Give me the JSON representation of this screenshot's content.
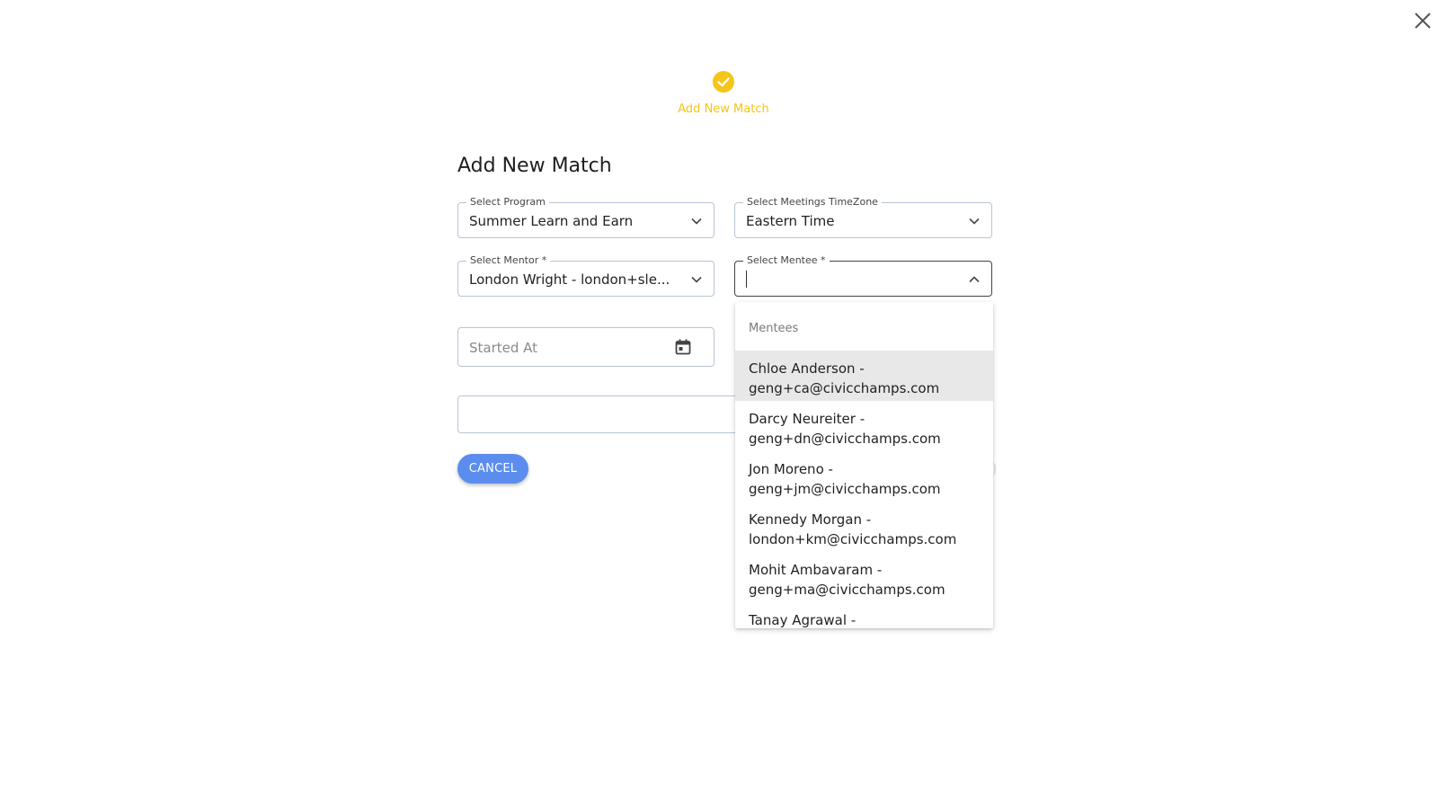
{
  "dialog": {
    "close_icon": "close-icon"
  },
  "stepper": {
    "icon": "check-circle-icon",
    "label": "Add New Match",
    "accent_color": "#f5c518"
  },
  "form": {
    "title": "Add New Match",
    "program": {
      "legend": "Select Program",
      "value": "Summer Learn and Earn"
    },
    "timezone": {
      "legend": "Select Meetings TimeZone",
      "value": "Eastern Time"
    },
    "mentor": {
      "legend": "Select Mentor *",
      "value": "London Wright - london+sle..."
    },
    "mentee": {
      "legend": "Select Mentee *",
      "value": ""
    },
    "started_at": {
      "placeholder": "Started At",
      "icon": "calendar-icon"
    },
    "cancel_label": "CANCEL",
    "button_color": "#5b8def"
  },
  "mentee_dropdown": {
    "header": "Mentees",
    "options": [
      {
        "name": "Chloe Anderson -",
        "email": "geng+ca@civicchamps.com"
      },
      {
        "name": "Darcy Neureiter -",
        "email": "geng+dn@civicchamps.com"
      },
      {
        "name": "Jon Moreno -",
        "email": "geng+jm@civicchamps.com"
      },
      {
        "name": "Kennedy Morgan -",
        "email": "london+km@civicchamps.com"
      },
      {
        "name": "Mohit Ambavaram -",
        "email": "geng+ma@civicchamps.com"
      },
      {
        "name": "Tanay Agrawal -",
        "email": ""
      }
    ]
  }
}
